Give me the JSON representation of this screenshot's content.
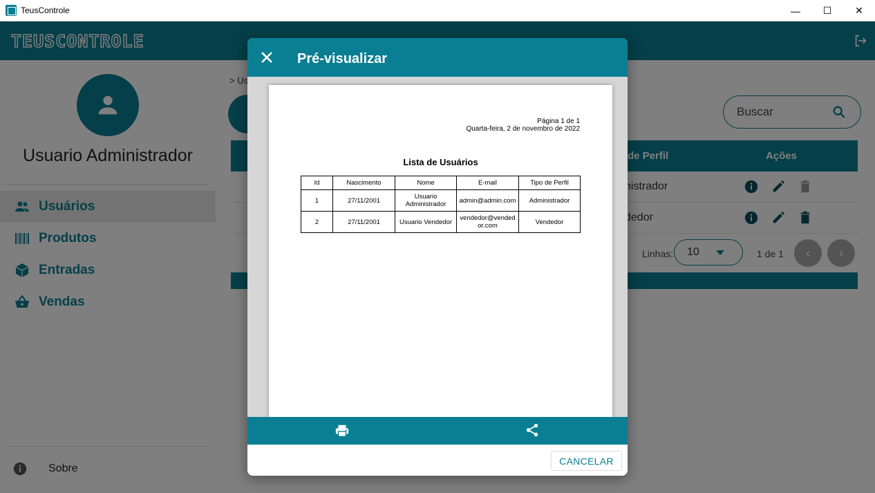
{
  "window": {
    "title": "TeusControle",
    "minimize": "—",
    "maximize": "☐",
    "close": "✕"
  },
  "header": {
    "logo_text": "TEUSCONTROLE"
  },
  "sidebar": {
    "user_name": "Usuario Administrador",
    "items": [
      {
        "label": "Usuários",
        "icon": "people-icon",
        "active": true
      },
      {
        "label": "Produtos",
        "icon": "barcode-icon",
        "active": false
      },
      {
        "label": "Entradas",
        "icon": "box-icon",
        "active": false
      },
      {
        "label": "Vendas",
        "icon": "basket-icon",
        "active": false
      }
    ],
    "about_label": "Sobre"
  },
  "main": {
    "breadcrumb": "> Us",
    "search_placeholder": "Buscar",
    "table": {
      "col_perfil": "de Perfil",
      "col_acoes": "Ações",
      "rows": [
        {
          "perfil": "nistrador"
        },
        {
          "perfil": "dedor"
        }
      ]
    },
    "pager": {
      "rows_label": "Linhas:",
      "rows_value": "10",
      "page_info": "1 de 1"
    }
  },
  "dialog": {
    "title": "Pré-visualizar",
    "cancel_label": "CANCELAR",
    "report": {
      "page": "Página 1 de 1",
      "date": "Quarta-feira, 2 de novembro de 2022",
      "title": "Lista de Usuários",
      "columns": [
        "Id",
        "Nascimento",
        "Nome",
        "E-mail",
        "Tipo de Perfil"
      ],
      "rows": [
        [
          "1",
          "27/11/2001",
          "Usuario Administrador",
          "admin@admin.com",
          "Administrador"
        ],
        [
          "2",
          "27/11/2001",
          "Usuario Vendedor",
          "vendedor@vendedor.com",
          "Vendedor"
        ]
      ]
    }
  },
  "colors": {
    "accent": "#0a7f93"
  }
}
